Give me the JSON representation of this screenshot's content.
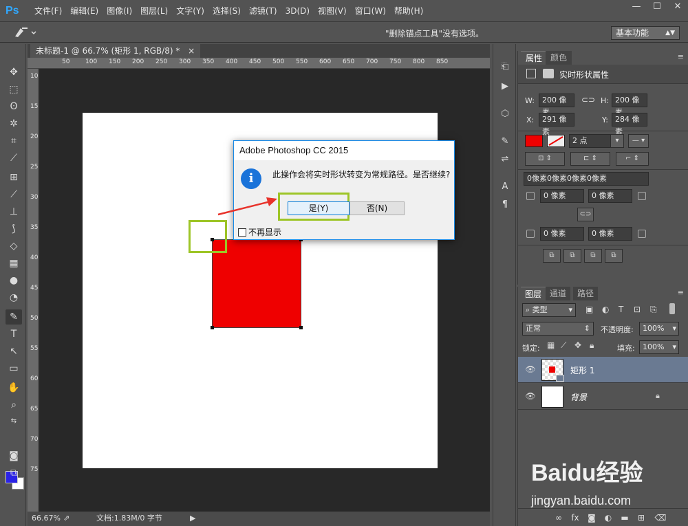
{
  "app": {
    "logo": "Ps",
    "accent": "#31a8ff"
  },
  "menu": [
    "文件(F)",
    "编辑(E)",
    "图像(I)",
    "图层(L)",
    "文字(Y)",
    "选择(S)",
    "滤镜(T)",
    "3D(D)",
    "视图(V)",
    "窗口(W)",
    "帮助(H)"
  ],
  "window_controls": {
    "minimize": "—",
    "maximize": "☐",
    "close": "✕"
  },
  "options_bar": {
    "hint": "\"删除锚点工具\"没有选项。",
    "workspace": "基本功能"
  },
  "document": {
    "tab_title": "未标题-1 @ 66.7% (矩形 1, RGB/8) *",
    "zoom": "66.67%",
    "info": "文档:1.83M/0 字节",
    "ruler_top_ticks": [
      "50",
      "100",
      "150",
      "200",
      "250",
      "300",
      "350",
      "400",
      "450",
      "500",
      "550",
      "600",
      "650",
      "700",
      "750",
      "800",
      "850"
    ],
    "ruler_left_ticks": [
      "100",
      "150",
      "200",
      "250",
      "300",
      "350",
      "400",
      "450",
      "500",
      "550",
      "600",
      "650",
      "700",
      "750"
    ],
    "shape_color": "#ef0000"
  },
  "dialog": {
    "title": "Adobe Photoshop CC 2015",
    "message": "此操作会将实时形状转变为常规路径。是否继续?",
    "yes_label": "是(Y)",
    "no_label": "否(N)",
    "dont_show_label": "不再显示",
    "info_glyph": "i"
  },
  "properties": {
    "tab_attributes": "属性",
    "tab_color": "颜色",
    "title": "实时形状属性",
    "w_label": "W:",
    "w_value": "200 像素",
    "h_label": "H:",
    "h_value": "200 像素",
    "x_label": "X:",
    "x_value": "291 像素",
    "y_label": "Y:",
    "y_value": "284 像素",
    "stroke_width": "2 点",
    "corner_all": "0像素0像素0像素0像素",
    "corner_tl": "0 像素",
    "corner_tr": "0 像素",
    "corner_bl": "0 像素",
    "corner_br": "0 像素",
    "fill_color": "#ef0000"
  },
  "layers": {
    "tab_layers": "图层",
    "tab_channels": "通道",
    "tab_paths": "路径",
    "filter_kind": "类型",
    "blend_mode": "正常",
    "opacity_label": "不透明度:",
    "opacity_value": "100%",
    "lock_label": "锁定:",
    "fill_label": "填充:",
    "fill_value": "100%",
    "items": [
      {
        "name": "矩形 1"
      },
      {
        "name": "背景"
      }
    ]
  },
  "watermark": {
    "text": "Baidu经验",
    "url": "jingyan.baidu.com"
  }
}
